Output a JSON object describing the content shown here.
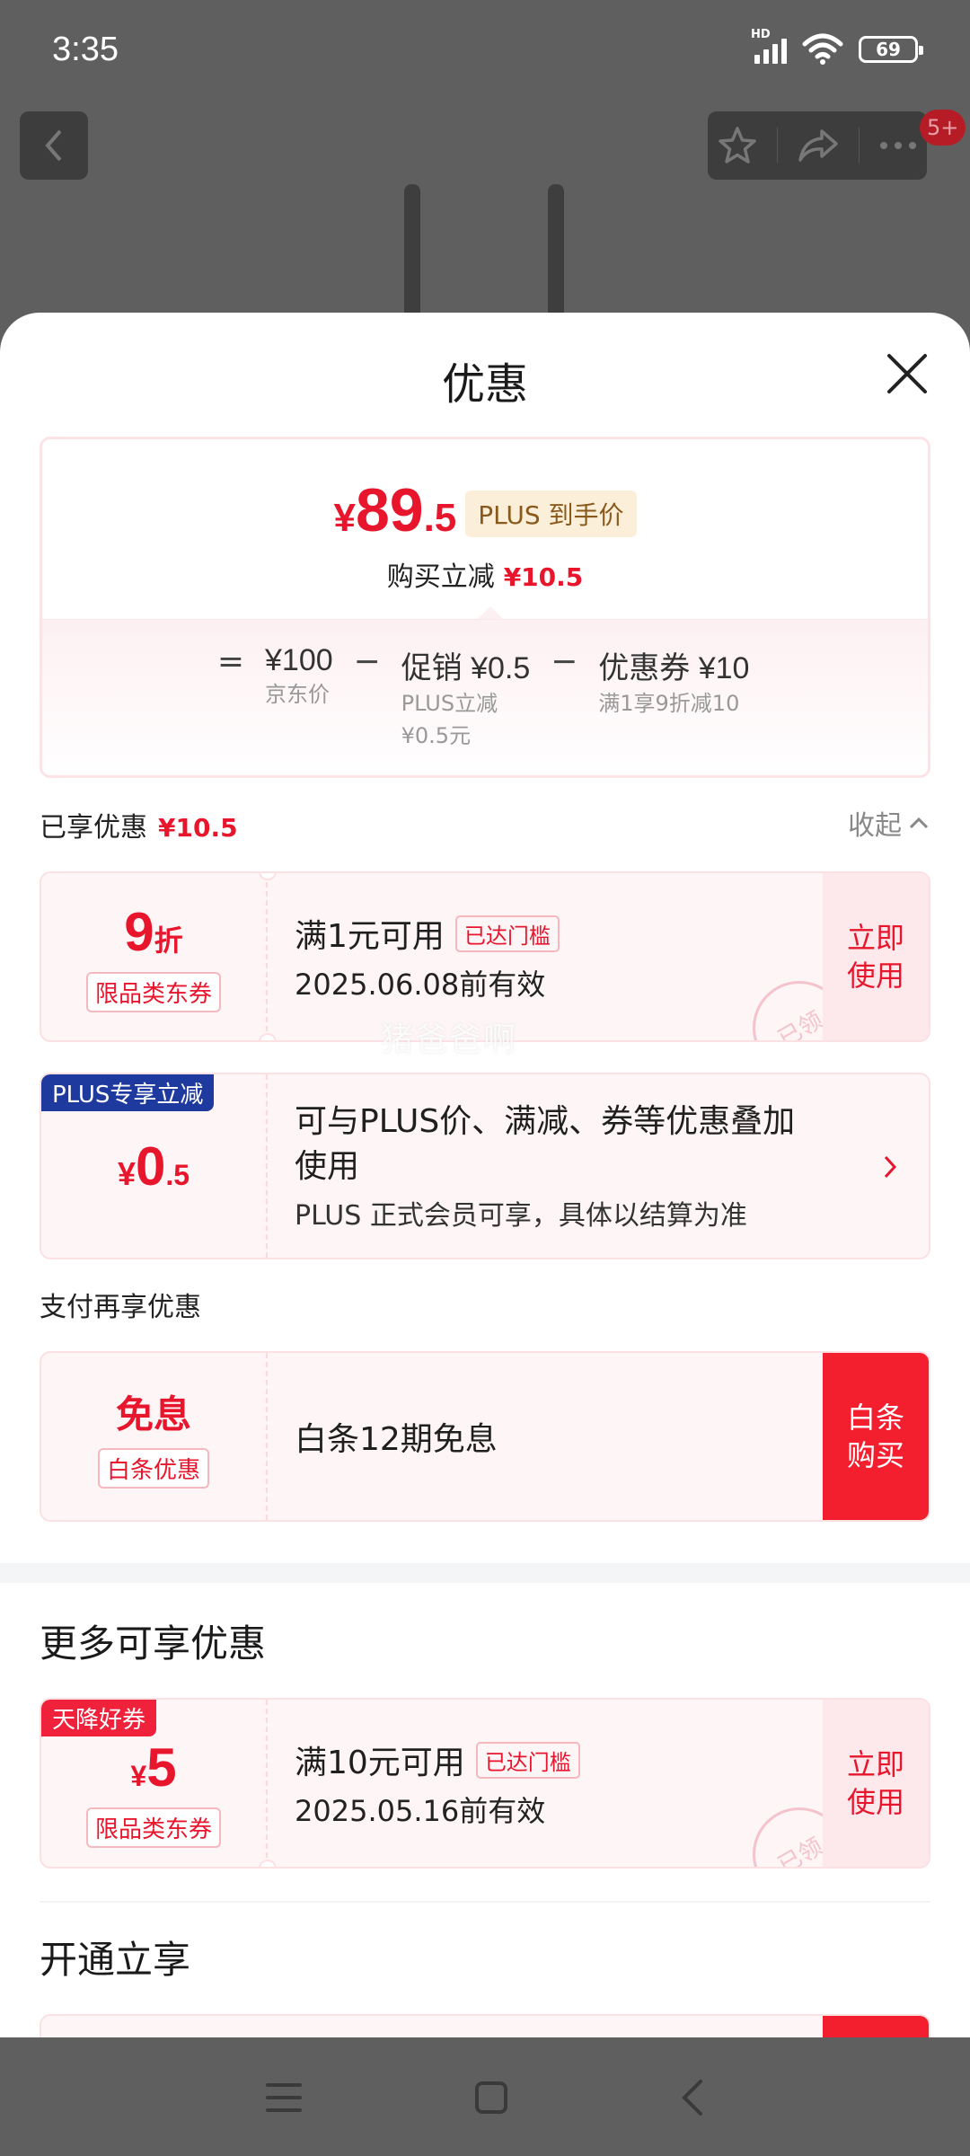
{
  "status_bar": {
    "time": "3:35",
    "network": "HD",
    "battery": "69"
  },
  "background": {
    "notification_badge": "5+"
  },
  "sheet": {
    "title": "优惠"
  },
  "summary": {
    "currency": "¥",
    "price_int": "89",
    "price_dec": ".5",
    "plus_tag": "PLUS 到手价",
    "reduce_label": "购买立减",
    "reduce_value": "¥10.5",
    "equals": "=",
    "minus": "−",
    "terms": [
      {
        "main": "¥100",
        "sub1": "京东价",
        "sub2": ""
      },
      {
        "main": "促销 ¥0.5",
        "sub1": "PLUS立减",
        "sub2": "¥0.5元"
      },
      {
        "main": "优惠券 ¥10",
        "sub1": "满1享9折减10",
        "sub2": ""
      }
    ]
  },
  "enjoyed": {
    "label": "已享优惠",
    "value": "¥10.5",
    "collapse_label": "收起"
  },
  "coupon1": {
    "big": "9",
    "unit": "折",
    "badge": "限品类东券",
    "title": "满1元可用",
    "threshold": "已达门槛",
    "date": "2025.06.08前有效",
    "action_line1": "立即",
    "action_line2": "使用",
    "stamp": "已领"
  },
  "watermark": "猪爸爸啊",
  "plus_card": {
    "tag": "PLUS专享立减",
    "currency": "¥",
    "int": "0",
    "dec": ".5",
    "line1": "可与PLUS价、满减、券等优惠叠加",
    "line2": "使用",
    "note": "PLUS 正式会员可享，具体以结算为准"
  },
  "pay_label": "支付再享优惠",
  "pay_card": {
    "big": "免息",
    "badge": "白条优惠",
    "title": "白条12期免息",
    "action_line1": "白条",
    "action_line2": "购买"
  },
  "more_title": "更多可享优惠",
  "coupon2": {
    "tag": "天降好券",
    "currency": "¥",
    "big": "5",
    "badge": "限品类东券",
    "title": "满10元可用",
    "threshold": "已达门槛",
    "date": "2025.05.16前有效",
    "action_line1": "立即",
    "action_line2": "使用",
    "stamp": "已领"
  },
  "open_title": "开通立享",
  "colors": {
    "accent": "#e8162d",
    "plus_blue": "#1f3a9e",
    "action_red": "#f31e2e"
  }
}
